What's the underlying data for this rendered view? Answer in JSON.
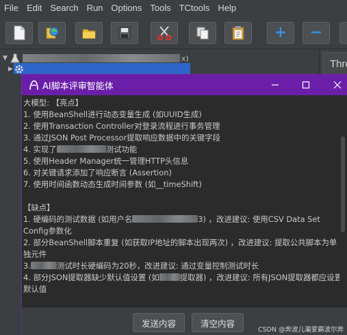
{
  "menu": [
    "File",
    "Edit",
    "Search",
    "Run",
    "Options",
    "Tools",
    "TCtools",
    "Help"
  ],
  "toolbar": {
    "icons": [
      "new-icon",
      "templates-icon",
      "open-icon",
      "save-icon",
      "cut-icon",
      "copy-icon",
      "paste-icon",
      "expand-icon",
      "collapse-icon"
    ],
    "expand_label": "+",
    "collapse_label": "−"
  },
  "tree": {
    "row1_suffix": "x)"
  },
  "right_panel": {
    "header": "Thre"
  },
  "dialog": {
    "title": "AI脚本评审智能体",
    "accent": "#6b1fa9",
    "lines": [
      "大模型: 【亮点】",
      "1. 使用BeanShell进行动态变量生成 (如UUID生成)",
      "2. 使用Transaction Controller对登录流程进行事务管理",
      "3. 通过JSON Post Processor提取响应数据中的关键字段",
      "4. 实现了",
      "测试功能",
      "5. 使用Header Manager统一管理HTTP头信息",
      "6. 对关键请求添加了响应断言 (Assertion)",
      "7. 使用时间函数动态生成时间参数 (如__timeShift)",
      "",
      "【缺点】",
      "1. 硬编码的测试数据 (如用户名",
      "3) ，改进建议: 使用CSV Data Set Config参数化",
      "2. 部分BeanShell脚本重复 (如获取IP地址的脚本出现两次) ，改进建议: 提取公共脚本为单独元件",
      "3.",
      "测试时长硬编码为20秒，改进建议: 通过变量控制测试时长",
      "4. 部分JSON提取器缺少默认值设置 (如",
      "提取器) ，改进建议: 所有JSON提取器都应设置默认值"
    ],
    "send_label": "发送内容",
    "clear_label": "清空内容",
    "watermark": "CSDN @奔波儿灞爱霸波尔奔"
  }
}
